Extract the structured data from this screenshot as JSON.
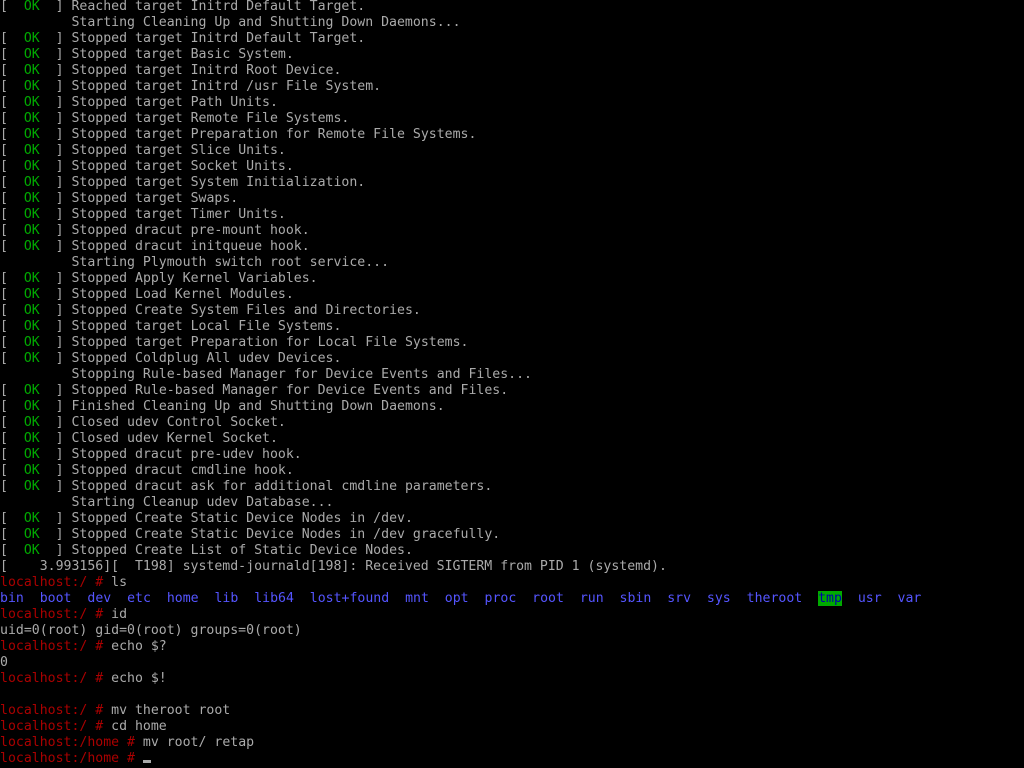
{
  "colors": {
    "background": "#000000",
    "text": "#aaaaaa",
    "ok": "#00aa00",
    "prompt": "#aa0000",
    "directory": "#5555ff",
    "sticky_dir_bg": "#00aa00"
  },
  "console": {
    "boot_lines": [
      {
        "status": "OK",
        "text": "Reached target Initrd Default Target."
      },
      {
        "status": "",
        "text": "Starting Cleaning Up and Shutting Down Daemons..."
      },
      {
        "status": "OK",
        "text": "Stopped target Initrd Default Target."
      },
      {
        "status": "OK",
        "text": "Stopped target Basic System."
      },
      {
        "status": "OK",
        "text": "Stopped target Initrd Root Device."
      },
      {
        "status": "OK",
        "text": "Stopped target Initrd /usr File System."
      },
      {
        "status": "OK",
        "text": "Stopped target Path Units."
      },
      {
        "status": "OK",
        "text": "Stopped target Remote File Systems."
      },
      {
        "status": "OK",
        "text": "Stopped target Preparation for Remote File Systems."
      },
      {
        "status": "OK",
        "text": "Stopped target Slice Units."
      },
      {
        "status": "OK",
        "text": "Stopped target Socket Units."
      },
      {
        "status": "OK",
        "text": "Stopped target System Initialization."
      },
      {
        "status": "OK",
        "text": "Stopped target Swaps."
      },
      {
        "status": "OK",
        "text": "Stopped target Timer Units."
      },
      {
        "status": "OK",
        "text": "Stopped dracut pre-mount hook."
      },
      {
        "status": "OK",
        "text": "Stopped dracut initqueue hook."
      },
      {
        "status": "",
        "text": "Starting Plymouth switch root service..."
      },
      {
        "status": "OK",
        "text": "Stopped Apply Kernel Variables."
      },
      {
        "status": "OK",
        "text": "Stopped Load Kernel Modules."
      },
      {
        "status": "OK",
        "text": "Stopped Create System Files and Directories."
      },
      {
        "status": "OK",
        "text": "Stopped target Local File Systems."
      },
      {
        "status": "OK",
        "text": "Stopped target Preparation for Local File Systems."
      },
      {
        "status": "OK",
        "text": "Stopped Coldplug All udev Devices."
      },
      {
        "status": "",
        "text": "Stopping Rule-based Manager for Device Events and Files..."
      },
      {
        "status": "OK",
        "text": "Stopped Rule-based Manager for Device Events and Files."
      },
      {
        "status": "OK",
        "text": "Finished Cleaning Up and Shutting Down Daemons."
      },
      {
        "status": "OK",
        "text": "Closed udev Control Socket."
      },
      {
        "status": "OK",
        "text": "Closed udev Kernel Socket."
      },
      {
        "status": "OK",
        "text": "Stopped dracut pre-udev hook."
      },
      {
        "status": "OK",
        "text": "Stopped dracut cmdline hook."
      },
      {
        "status": "OK",
        "text": "Stopped dracut ask for additional cmdline parameters."
      },
      {
        "status": "",
        "text": "Starting Cleanup udev Database..."
      },
      {
        "status": "OK",
        "text": "Stopped Create Static Device Nodes in /dev."
      },
      {
        "status": "OK",
        "text": "Stopped Create Static Device Nodes in /dev gracefully."
      },
      {
        "status": "OK",
        "text": "Stopped Create List of Static Device Nodes."
      }
    ],
    "kernel_message": "[    3.993156][  T198] systemd-journald[198]: Received SIGTERM from PID 1 (systemd).",
    "session": [
      {
        "type": "prompt",
        "prompt": "localhost:/ # ",
        "command": "ls"
      },
      {
        "type": "ls",
        "entries": [
          "bin",
          "boot",
          "dev",
          "etc",
          "home",
          "lib",
          "lib64",
          "lost+found",
          "mnt",
          "opt",
          "proc",
          "root",
          "run",
          "sbin",
          "srv",
          "sys",
          "theroot",
          "tmp",
          "usr",
          "var"
        ]
      },
      {
        "type": "prompt",
        "prompt": "localhost:/ # ",
        "command": "id"
      },
      {
        "type": "output",
        "text": "uid=0(root) gid=0(root) groups=0(root)"
      },
      {
        "type": "prompt",
        "prompt": "localhost:/ # ",
        "command": "echo $?"
      },
      {
        "type": "output",
        "text": "0"
      },
      {
        "type": "prompt",
        "prompt": "localhost:/ # ",
        "command": "echo $!"
      },
      {
        "type": "output",
        "text": ""
      },
      {
        "type": "prompt",
        "prompt": "localhost:/ # ",
        "command": "mv theroot root"
      },
      {
        "type": "prompt",
        "prompt": "localhost:/ # ",
        "command": "cd home"
      },
      {
        "type": "prompt",
        "prompt": "localhost:/home # ",
        "command": "mv root/ retap"
      },
      {
        "type": "prompt",
        "prompt": "localhost:/home # ",
        "command": "",
        "cursor": true
      }
    ],
    "sticky_entries": [
      "tmp"
    ]
  }
}
